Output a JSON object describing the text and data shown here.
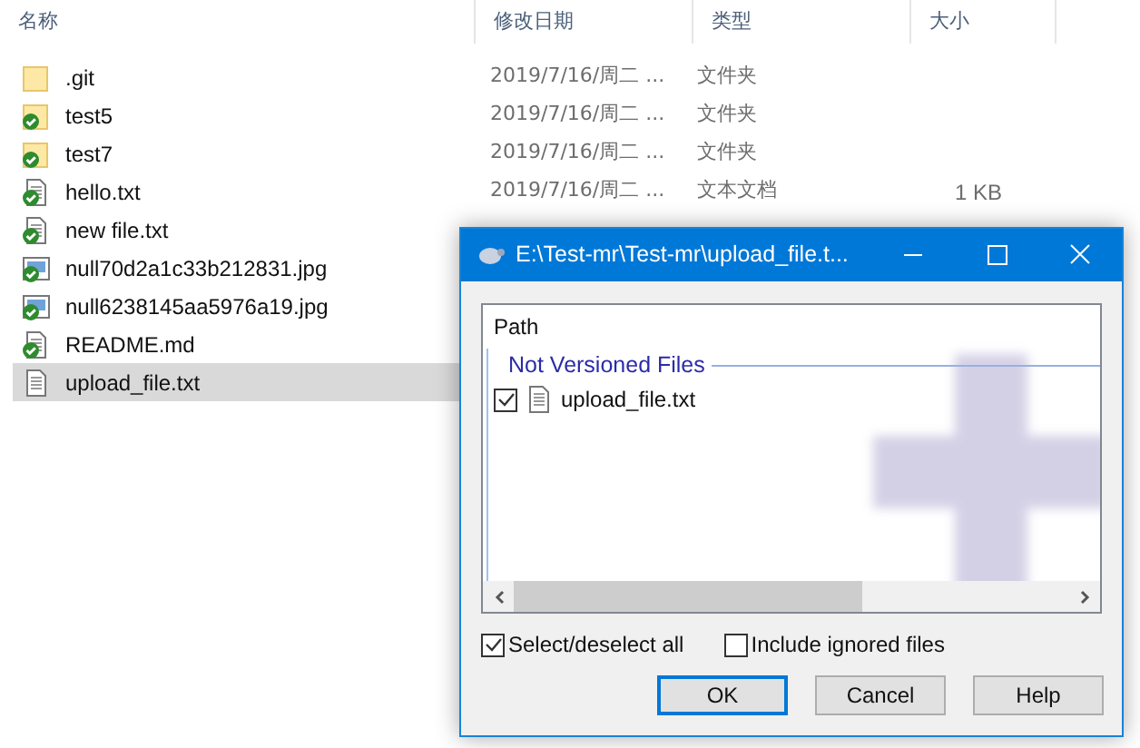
{
  "explorer": {
    "columns": [
      "名称",
      "修改日期",
      "类型",
      "大小"
    ],
    "rows": [
      {
        "name": ".git",
        "kind": "folder",
        "versioned": false,
        "date": "2019/7/16/周二 ...",
        "type": "文件夹",
        "size": "",
        "selected": false
      },
      {
        "name": "test5",
        "kind": "folder",
        "versioned": true,
        "date": "2019/7/16/周二 ...",
        "type": "文件夹",
        "size": "",
        "selected": false
      },
      {
        "name": "test7",
        "kind": "folder",
        "versioned": true,
        "date": "2019/7/16/周二 ...",
        "type": "文件夹",
        "size": "",
        "selected": false
      },
      {
        "name": "hello.txt",
        "kind": "text",
        "versioned": true,
        "date": "2019/7/16/周二 ...",
        "type": "文本文档",
        "size": "1 KB",
        "selected": false
      },
      {
        "name": "new file.txt",
        "kind": "text",
        "versioned": true,
        "selected": false
      },
      {
        "name": "null70d2a1c33b212831.jpg",
        "kind": "image",
        "versioned": true,
        "selected": false
      },
      {
        "name": "null6238145aa5976a19.jpg",
        "kind": "image",
        "versioned": true,
        "selected": false
      },
      {
        "name": "README.md",
        "kind": "text",
        "versioned": true,
        "selected": false
      },
      {
        "name": "upload_file.txt",
        "kind": "text",
        "versioned": false,
        "selected": true
      }
    ]
  },
  "dialog": {
    "title": "E:\\Test-mr\\Test-mr\\upload_file.t...",
    "list_header": "Path",
    "group": "Not Versioned Files",
    "items": [
      {
        "name": "upload_file.txt",
        "checked": true
      }
    ],
    "options": [
      {
        "label": "Select/deselect all",
        "checked": true
      },
      {
        "label": "Include ignored files",
        "checked": false
      }
    ],
    "buttons": [
      {
        "label": "OK",
        "selected": true
      },
      {
        "label": "Cancel",
        "selected": false
      },
      {
        "label": "Help",
        "selected": false
      }
    ]
  }
}
